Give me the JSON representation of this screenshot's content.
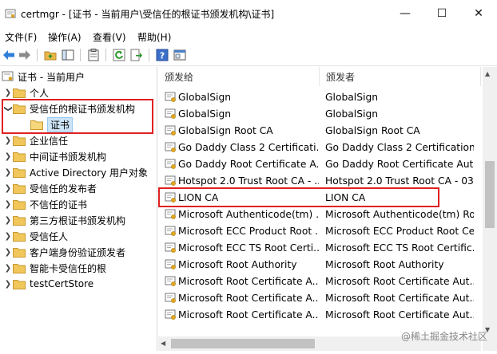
{
  "window": {
    "title": "certmgr - [证书 - 当前用户\\受信任的根证书颁发机构\\证书]",
    "controls": [
      "—",
      "☐",
      "✕"
    ]
  },
  "menu": [
    "文件(F)",
    "操作(A)",
    "查看(V)",
    "帮助(H)"
  ],
  "toolbar": {
    "icons": [
      "back-arrow-icon",
      "forward-arrow-icon",
      "up-folder-icon",
      "show-hide-tree-icon",
      "properties-icon",
      "refresh-icon",
      "export-list-icon",
      "help-icon",
      "console-icon"
    ]
  },
  "tree": {
    "root": "证书 - 当前用户",
    "items": [
      {
        "label": "个人",
        "expanded": false
      },
      {
        "label": "受信任的根证书颁发机构",
        "expanded": true
      },
      {
        "label": "证书",
        "child": true,
        "selected": true
      },
      {
        "label": "企业信任",
        "expanded": false
      },
      {
        "label": "中间证书颁发机构",
        "expanded": false
      },
      {
        "label": "Active Directory 用户对象",
        "expanded": false
      },
      {
        "label": "受信任的发布者",
        "expanded": false
      },
      {
        "label": "不信任的证书",
        "expanded": false
      },
      {
        "label": "第三方根证书颁发机构",
        "expanded": false
      },
      {
        "label": "受信任人",
        "expanded": false
      },
      {
        "label": "客户端身份验证颁发者",
        "expanded": false
      },
      {
        "label": "智能卡受信任的根",
        "expanded": false
      },
      {
        "label": "testCertStore",
        "expanded": false
      }
    ]
  },
  "list": {
    "columns": [
      "颁发给",
      "颁发者"
    ],
    "rows": [
      {
        "to": "GlobalSign",
        "by": "GlobalSign"
      },
      {
        "to": "GlobalSign",
        "by": "GlobalSign"
      },
      {
        "to": "GlobalSign Root CA",
        "by": "GlobalSign Root CA"
      },
      {
        "to": "Go Daddy Class 2 Certificati...",
        "by": "Go Daddy Class 2 Certification..."
      },
      {
        "to": "Go Daddy Root Certificate A...",
        "by": "Go Daddy Root Certificate Aut..."
      },
      {
        "to": "Hotspot 2.0 Trust Root CA - ...",
        "by": "Hotspot 2.0 Trust Root CA - 03"
      },
      {
        "to": "LION CA",
        "by": "LION CA",
        "highlight": true
      },
      {
        "to": "Microsoft Authenticode(tm) ...",
        "by": "Microsoft Authenticode(tm) Ro..."
      },
      {
        "to": "Microsoft ECC Product Root ...",
        "by": "Microsoft ECC Product Root Ce..."
      },
      {
        "to": "Microsoft ECC TS Root Certi...",
        "by": "Microsoft ECC TS Root Certific..."
      },
      {
        "to": "Microsoft Root Authority",
        "by": "Microsoft Root Authority"
      },
      {
        "to": "Microsoft Root Certificate A...",
        "by": "Microsoft Root Certificate Aut..."
      },
      {
        "to": "Microsoft Root Certificate A...",
        "by": "Microsoft Root Certificate Aut..."
      },
      {
        "to": "Microsoft Root Certificate A...",
        "by": "Microsoft Root Certificate Aut..."
      }
    ]
  },
  "watermark": "@稀土掘金技术社区",
  "colors": {
    "highlight_box": "#e02020",
    "selection": "#cce4f7",
    "folder": "#e8b84a"
  }
}
